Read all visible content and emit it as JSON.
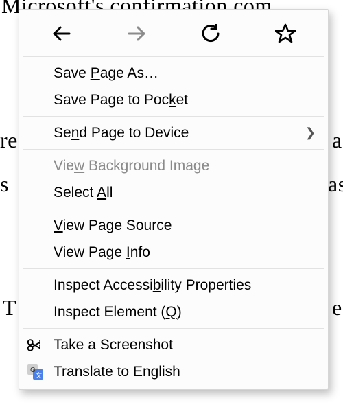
{
  "background": {
    "line1": "Microsoft's confirmation com",
    "line2": "re",
    "line3": "a",
    "line4": "s",
    "line5": "as",
    "line6": "T",
    "line7": "e"
  },
  "nav": {
    "back": "Back",
    "forward": "Forward",
    "reload": "Reload",
    "bookmark": "Bookmark"
  },
  "items": {
    "savePageAs": {
      "pre": "Save ",
      "u": "P",
      "post": "age As…"
    },
    "saveToPocket": {
      "pre": "Save Page to Poc",
      "u": "k",
      "post": "et"
    },
    "sendToDevice": {
      "pre": "Se",
      "u": "n",
      "post": "d Page to Device"
    },
    "viewBgImage": {
      "pre": "Vie",
      "u": "w",
      "post": " Background Image"
    },
    "selectAll": {
      "pre": "Select ",
      "u": "A",
      "post": "ll"
    },
    "viewSource": {
      "u": "V",
      "post": "iew Page Source"
    },
    "viewInfo": {
      "pre": "View Page ",
      "u": "I",
      "post": "nfo"
    },
    "inspectA11y": {
      "pre": "Inspect Accessi",
      "u": "b",
      "post": "ility Properties"
    },
    "inspectEl": {
      "pre": "Inspect Element (",
      "u": "Q",
      "post": ")"
    },
    "screenshot": {
      "text": "Take a Screenshot"
    },
    "translate": {
      "text": "Translate to English"
    }
  }
}
